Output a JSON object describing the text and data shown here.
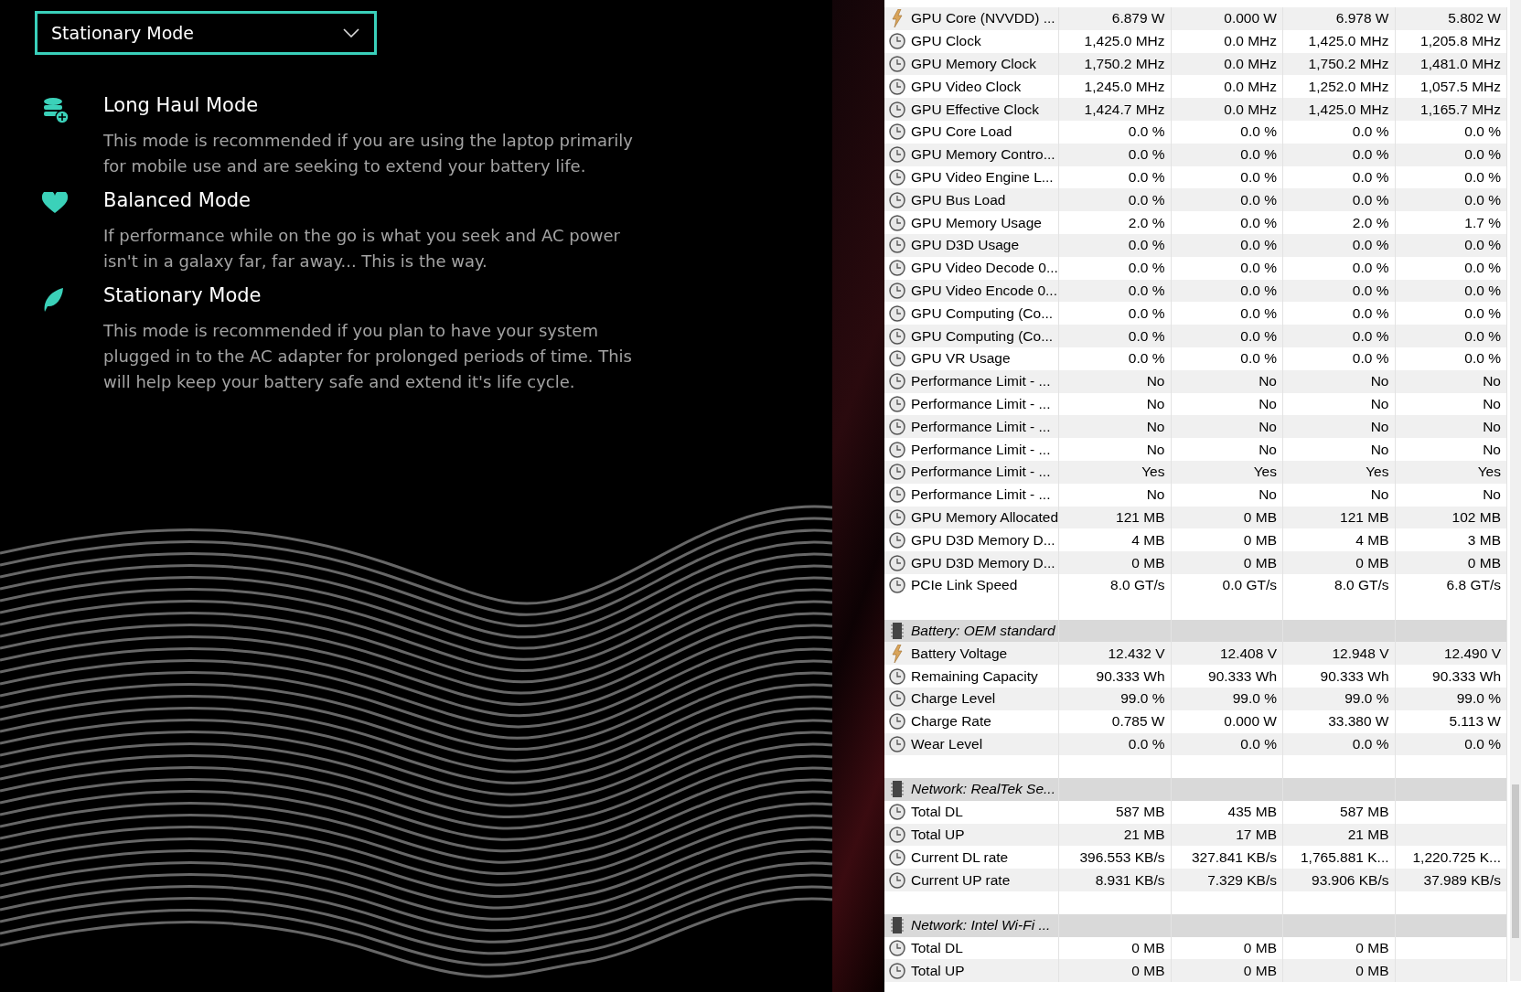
{
  "mode_select": {
    "value": "Stationary Mode"
  },
  "modes": [
    {
      "kind": "database",
      "title": "Long Haul Mode",
      "description": "This mode is recommended if you are using the laptop primarily for mobile use and are seeking to extend your battery life."
    },
    {
      "kind": "heart",
      "title": "Balanced Mode",
      "description": "If performance while on the go is what you seek and AC power isn't in a galaxy far, far away... This is the way."
    },
    {
      "kind": "leaf",
      "title": "Stationary Mode",
      "description": "This mode is recommended if you plan to have your system plugged in to the AC adapter for prolonged periods of time. This will help keep your battery safe and extend it's life cycle."
    }
  ],
  "sensor_table": {
    "rows": [
      {
        "kind": "power",
        "name": "GPU Core (NVVDD) ...",
        "values": [
          "6.879 W",
          "0.000 W",
          "6.978 W",
          "5.802 W"
        ]
      },
      {
        "kind": "sensor",
        "name": "GPU Clock",
        "values": [
          "1,425.0 MHz",
          "0.0 MHz",
          "1,425.0 MHz",
          "1,205.8 MHz"
        ]
      },
      {
        "kind": "sensor",
        "name": "GPU Memory Clock",
        "values": [
          "1,750.2 MHz",
          "0.0 MHz",
          "1,750.2 MHz",
          "1,481.0 MHz"
        ]
      },
      {
        "kind": "sensor",
        "name": "GPU Video Clock",
        "values": [
          "1,245.0 MHz",
          "0.0 MHz",
          "1,252.0 MHz",
          "1,057.5 MHz"
        ]
      },
      {
        "kind": "sensor",
        "name": "GPU Effective Clock",
        "values": [
          "1,424.7 MHz",
          "0.0 MHz",
          "1,425.0 MHz",
          "1,165.7 MHz"
        ]
      },
      {
        "kind": "sensor",
        "name": "GPU Core Load",
        "values": [
          "0.0 %",
          "0.0 %",
          "0.0 %",
          "0.0 %"
        ]
      },
      {
        "kind": "sensor",
        "name": "GPU Memory Contro...",
        "values": [
          "0.0 %",
          "0.0 %",
          "0.0 %",
          "0.0 %"
        ]
      },
      {
        "kind": "sensor",
        "name": "GPU Video Engine L...",
        "values": [
          "0.0 %",
          "0.0 %",
          "0.0 %",
          "0.0 %"
        ]
      },
      {
        "kind": "sensor",
        "name": "GPU Bus Load",
        "values": [
          "0.0 %",
          "0.0 %",
          "0.0 %",
          "0.0 %"
        ]
      },
      {
        "kind": "sensor",
        "name": "GPU Memory Usage",
        "values": [
          "2.0 %",
          "0.0 %",
          "2.0 %",
          "1.7 %"
        ]
      },
      {
        "kind": "sensor",
        "name": "GPU D3D Usage",
        "values": [
          "0.0 %",
          "0.0 %",
          "0.0 %",
          "0.0 %"
        ]
      },
      {
        "kind": "sensor",
        "name": "GPU Video Decode 0...",
        "values": [
          "0.0 %",
          "0.0 %",
          "0.0 %",
          "0.0 %"
        ]
      },
      {
        "kind": "sensor",
        "name": "GPU Video Encode 0...",
        "values": [
          "0.0 %",
          "0.0 %",
          "0.0 %",
          "0.0 %"
        ]
      },
      {
        "kind": "sensor",
        "name": "GPU Computing (Co...",
        "values": [
          "0.0 %",
          "0.0 %",
          "0.0 %",
          "0.0 %"
        ]
      },
      {
        "kind": "sensor",
        "name": "GPU Computing (Co...",
        "values": [
          "0.0 %",
          "0.0 %",
          "0.0 %",
          "0.0 %"
        ]
      },
      {
        "kind": "sensor",
        "name": "GPU VR Usage",
        "values": [
          "0.0 %",
          "0.0 %",
          "0.0 %",
          "0.0 %"
        ]
      },
      {
        "kind": "sensor",
        "name": "Performance Limit - ...",
        "values": [
          "No",
          "No",
          "No",
          "No"
        ]
      },
      {
        "kind": "sensor",
        "name": "Performance Limit - ...",
        "values": [
          "No",
          "No",
          "No",
          "No"
        ]
      },
      {
        "kind": "sensor",
        "name": "Performance Limit - ...",
        "values": [
          "No",
          "No",
          "No",
          "No"
        ]
      },
      {
        "kind": "sensor",
        "name": "Performance Limit - ...",
        "values": [
          "No",
          "No",
          "No",
          "No"
        ]
      },
      {
        "kind": "sensor",
        "name": "Performance Limit - ...",
        "values": [
          "Yes",
          "Yes",
          "Yes",
          "Yes"
        ]
      },
      {
        "kind": "sensor",
        "name": "Performance Limit - ...",
        "values": [
          "No",
          "No",
          "No",
          "No"
        ]
      },
      {
        "kind": "sensor",
        "name": "GPU Memory Allocated",
        "values": [
          "121 MB",
          "0 MB",
          "121 MB",
          "102 MB"
        ]
      },
      {
        "kind": "sensor",
        "name": "GPU D3D Memory D...",
        "values": [
          "4 MB",
          "0 MB",
          "4 MB",
          "3 MB"
        ]
      },
      {
        "kind": "sensor",
        "name": "GPU D3D Memory D...",
        "values": [
          "0 MB",
          "0 MB",
          "0 MB",
          "0 MB"
        ]
      },
      {
        "kind": "sensor",
        "name": "PCIe Link Speed",
        "values": [
          "8.0 GT/s",
          "0.0 GT/s",
          "8.0 GT/s",
          "6.8 GT/s"
        ]
      },
      {
        "kind": "spacer"
      },
      {
        "kind": "group",
        "name": "Battery: OEM standard"
      },
      {
        "kind": "power",
        "name": "Battery Voltage",
        "values": [
          "12.432 V",
          "12.408 V",
          "12.948 V",
          "12.490 V"
        ]
      },
      {
        "kind": "sensor",
        "name": "Remaining Capacity",
        "values": [
          "90.333 Wh",
          "90.333 Wh",
          "90.333 Wh",
          "90.333 Wh"
        ]
      },
      {
        "kind": "sensor",
        "name": "Charge Level",
        "values": [
          "99.0 %",
          "99.0 %",
          "99.0 %",
          "99.0 %"
        ]
      },
      {
        "kind": "sensor",
        "name": "Charge Rate",
        "values": [
          "0.785 W",
          "0.000 W",
          "33.380 W",
          "5.113 W"
        ]
      },
      {
        "kind": "sensor",
        "name": "Wear Level",
        "values": [
          "0.0 %",
          "0.0 %",
          "0.0 %",
          "0.0 %"
        ]
      },
      {
        "kind": "spacer"
      },
      {
        "kind": "group",
        "name": "Network: RealTek Se..."
      },
      {
        "kind": "sensor",
        "name": "Total DL",
        "values": [
          "587 MB",
          "435 MB",
          "587 MB"
        ]
      },
      {
        "kind": "sensor",
        "name": "Total UP",
        "values": [
          "21 MB",
          "17 MB",
          "21 MB"
        ]
      },
      {
        "kind": "sensor",
        "name": "Current DL rate",
        "values": [
          "396.553 KB/s",
          "327.841 KB/s",
          "1,765.881 K...",
          "1,220.725 K..."
        ]
      },
      {
        "kind": "sensor",
        "name": "Current UP rate",
        "values": [
          "8.931 KB/s",
          "7.329 KB/s",
          "93.906 KB/s",
          "37.989 KB/s"
        ]
      },
      {
        "kind": "spacer"
      },
      {
        "kind": "group",
        "name": "Network: Intel Wi-Fi ..."
      },
      {
        "kind": "sensor",
        "name": "Total DL",
        "values": [
          "0 MB",
          "0 MB",
          "0 MB"
        ]
      },
      {
        "kind": "sensor",
        "name": "Total UP",
        "values": [
          "0 MB",
          "0 MB",
          "0 MB"
        ]
      }
    ]
  }
}
